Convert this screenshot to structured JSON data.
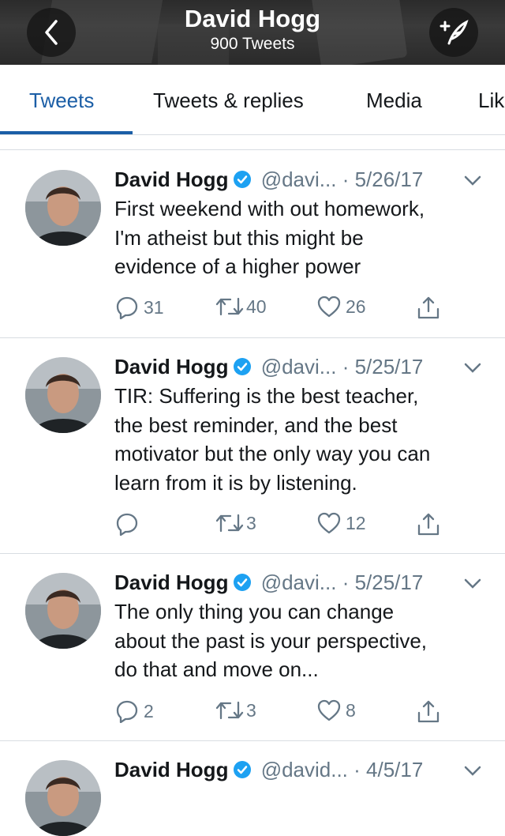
{
  "header": {
    "title": "David Hogg",
    "subtitle": "900 Tweets",
    "back_icon": "chevron-left-icon",
    "compose_icon": "compose-tweet-icon"
  },
  "tabs": [
    {
      "label": "Tweets",
      "active": true
    },
    {
      "label": "Tweets & replies",
      "active": false
    },
    {
      "label": "Media",
      "active": false
    },
    {
      "label": "Lik",
      "active": false
    }
  ],
  "colors": {
    "accent": "#1b5ea6",
    "muted": "#657786",
    "verified": "#1da1f2"
  },
  "tweets": [
    {
      "name": "David Hogg",
      "handle": "@davi...",
      "date": "· 5/26/17",
      "lines": [
        "First weekend with out homework,",
        "I'm atheist but this might be",
        "evidence of a higher power"
      ],
      "replies": "31",
      "retweets": "40",
      "likes": "26"
    },
    {
      "name": "David Hogg",
      "handle": "@davi...",
      "date": "· 5/25/17",
      "lines": [
        "TIR: Suffering is the best teacher,",
        "the best reminder, and the best",
        "motivator but the only way you can",
        "learn from it is by listening."
      ],
      "replies": "",
      "retweets": "3",
      "likes": "12"
    },
    {
      "name": "David Hogg",
      "handle": "@davi...",
      "date": "· 5/25/17",
      "lines": [
        "The only thing you can change",
        "about the past is your perspective,",
        "do that and move on..."
      ],
      "replies": "2",
      "retweets": "3",
      "likes": "8"
    },
    {
      "name": "David Hogg",
      "handle": "@david...",
      "date": "· 4/5/17",
      "lines": [],
      "replies": "",
      "retweets": "",
      "likes": ""
    }
  ]
}
